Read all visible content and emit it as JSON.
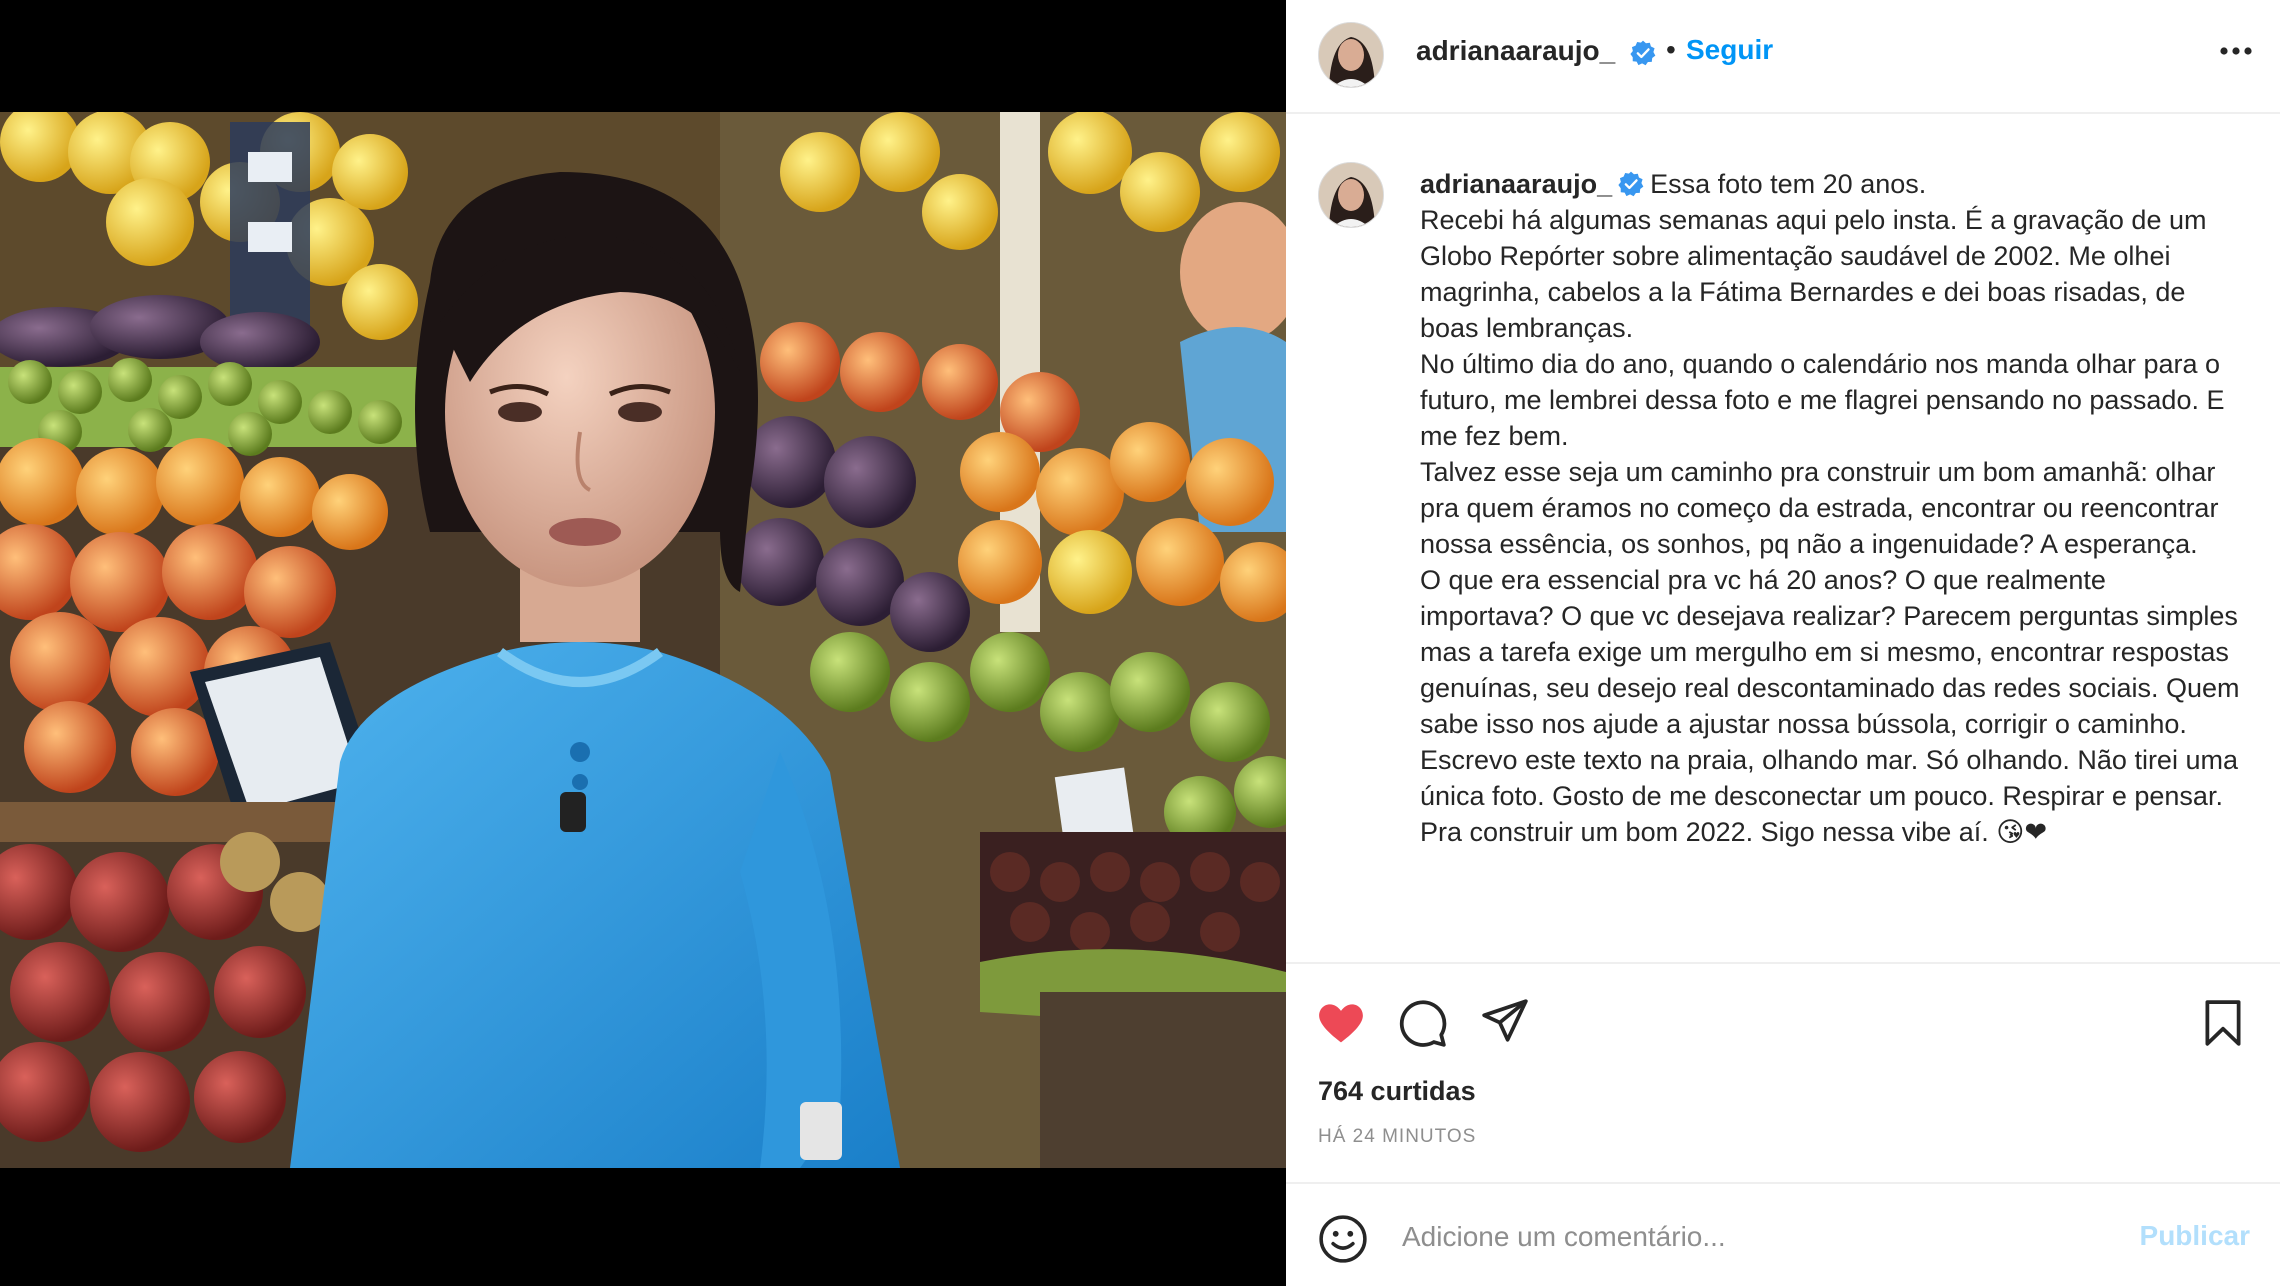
{
  "post": {
    "username": "adrianaaraujo_",
    "follow_label": "Seguir",
    "dot": "•",
    "caption_first": "Essa foto tem 20 anos.",
    "caption_body": "Recebi há algumas semanas aqui pelo insta. É a gravação de um Globo Repórter sobre alimentação saudável de 2002. Me olhei magrinha, cabelos a la Fátima Bernardes e dei boas risadas, de boas lembranças.\nNo último dia do ano, quando o calendário nos manda olhar para o futuro, me lembrei dessa foto e me flagrei pensando no passado. E me fez bem.\nTalvez esse seja um caminho pra construir um bom amanhã: olhar pra quem éramos no começo da estrada, encontrar ou reencontrar nossa essência, os sonhos, pq não a ingenuidade? A esperança.\nO que era essencial pra vc há 20 anos? O que realmente importava? O que vc desejava realizar? Parecem perguntas simples mas a tarefa exige um mergulho em si mesmo, encontrar respostas genuínas, seu desejo real descontaminado das redes sociais. Quem sabe isso nos ajude a ajustar nossa bússola, corrigir o caminho. Escrevo este texto na praia, olhando mar. Só olhando. Não tirei uma única foto. Gosto de me desconectar um pouco. Respirar e pensar. Pra construir um bom 2022. Sigo nessa vibe aí. 😘❤"
  },
  "stats": {
    "likes": "764 curtidas",
    "time": "HÁ 24 MINUTOS"
  },
  "comment": {
    "placeholder": "Adicione um comentário...",
    "publish_label": "Publicar"
  },
  "icons": {
    "like": "heart-filled-icon",
    "comment": "comment-bubble-icon",
    "share": "paper-plane-icon",
    "save": "bookmark-icon",
    "more": "more-dots-icon",
    "emoji": "emoji-smile-icon",
    "verified": "verified-badge-icon"
  },
  "colors": {
    "like_red": "#ed4956",
    "link_blue": "#0095f6",
    "publish_disabled": "#b2dffc",
    "verified_blue": "#3897f0",
    "muted_text": "#8e8e8e"
  }
}
